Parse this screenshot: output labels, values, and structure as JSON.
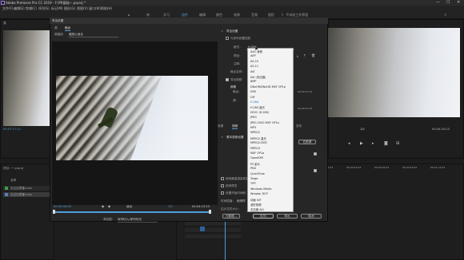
{
  "window": {
    "title": "Adobe Premiere Pro CC 2019 - F:\\PR基础一.prproj *",
    "minimize": "—",
    "maximize": "☐",
    "close": "✕"
  },
  "menu": [
    "文件(F)",
    "编辑(E)",
    "剪辑(C)",
    "序列(S)",
    "标记(M)",
    "图形(G)",
    "视图(V)",
    "窗口(W)",
    "帮助(H)"
  ],
  "workspaces": {
    "items": [
      "库",
      "学习",
      "组件",
      "编辑",
      "颜色",
      "效果",
      "音频",
      "图形",
      "库",
      "》 不米前工作界面"
    ],
    "active_index": 3
  },
  "source_monitor": {
    "tab": "源",
    "timecode": "00:07:17:12"
  },
  "project_panel": {
    "tab": "项目: 一 prproj",
    "column": "名称",
    "items": [
      "瓦达加里雷.mov",
      "瓦达加里雷.mov"
    ]
  },
  "program_monitor": {
    "timecode_right": "00:04:20:23",
    "resolution": "1/2"
  },
  "timeline": {
    "ruler": [
      "00:00:14:23",
      "00:00:29:23",
      "00:00:44:22",
      "00:00:59:22",
      "00:01:14:22"
    ]
  },
  "dialog": {
    "title": "导出设置",
    "tabs": [
      "源",
      "输出"
    ],
    "active_tab": "输出",
    "source_scaling_label": "源缩放：",
    "source_scaling_value": "缩放以适合",
    "timecode_start": "00:00:00:00",
    "timecode_mid": "1/2",
    "timecode_end": "00:04:13:23",
    "fit_label": "适合",
    "source_range_label": "源范围：",
    "source_range_value": "序列切入/序列切出",
    "export_settings_heading": "导出设置",
    "match_sequence_label": "与序列设置匹配",
    "format_label": "格式：",
    "format_value": "H.264",
    "preset_label": "预设：",
    "comments_label": "注释：",
    "output_name_label": "输出名称：",
    "export_video_label": "导出视频",
    "summary_label": "摘要",
    "output_label": "输出：",
    "source_label": "源：",
    "source_detail_1": "00:00:13:13",
    "source_detail_2": "00:00:13:13",
    "lower_tabs": [
      "效果",
      "视频",
      "音频",
      "多路复用器",
      "字幕",
      "发布"
    ],
    "lower_active_tab": "视频",
    "basic_video_heading": "基本视频设置",
    "match_source_button": "匹配源",
    "use_max_render_label": "使用最高渲染质量",
    "use_previews_label": "使用预览",
    "set_start_tc_label": "设置开始时间码",
    "time_interpolation_label": "时间插值：",
    "time_interpolation_value": "帧采样",
    "file_size_label": "估计文件大小：",
    "file_size_value": "",
    "metadata_button": "元数据...",
    "queue_button": "队列",
    "export_button": "导出",
    "cancel_button": "取消"
  },
  "format_dropdown": {
    "selected": "H.264",
    "options": [
      "AAC 音频",
      "AIFF",
      "AS-10",
      "AS-11",
      "AVI",
      "AVI (未压缩)",
      "BMP",
      "DNxHR/DNxHD MXF OP1a",
      "DPX",
      "GIF",
      "H.264",
      "H.264 蓝光",
      "HEVC (H.265)",
      "JPEG",
      "JPEG 2000 MXF OP1a",
      "MP3",
      "MPEG2",
      "MPEG2 蓝光",
      "MPEG2-DVD",
      "MPEG4",
      "MXF OP1a",
      "OpenEXR",
      "P2 影片",
      "PNG",
      "QuickTime",
      "Targa",
      "TIFF",
      "Windows Media",
      "Wraptor DCP",
      "动画 GIF",
      "波形音频",
      "无压缩 AVI"
    ]
  },
  "colors": {
    "accent": "#4f9ed8",
    "panel": "#262626",
    "dropdown_bg": "#f3f3f3"
  }
}
